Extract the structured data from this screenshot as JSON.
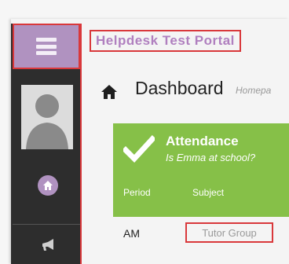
{
  "header": {
    "portal_title": "Helpdesk Test Portal",
    "menu_icon": "hamburger-icon"
  },
  "sidebar": {
    "avatar_icon": "user-silhouette-icon",
    "home_icon": "home-icon",
    "flag_icon": "megaphone-icon"
  },
  "page": {
    "title": "Dashboard",
    "subtitle": "Homepa",
    "title_icon": "home-icon"
  },
  "attendance": {
    "title": "Attendance",
    "question": "Is Emma at school?",
    "columns": [
      "Period",
      "Subject"
    ],
    "rows": [
      {
        "period": "AM",
        "subject": "Tutor Group"
      }
    ],
    "colors": {
      "card": "#86c048",
      "accent": "#b092c0",
      "highlight": "#d9383b"
    }
  }
}
